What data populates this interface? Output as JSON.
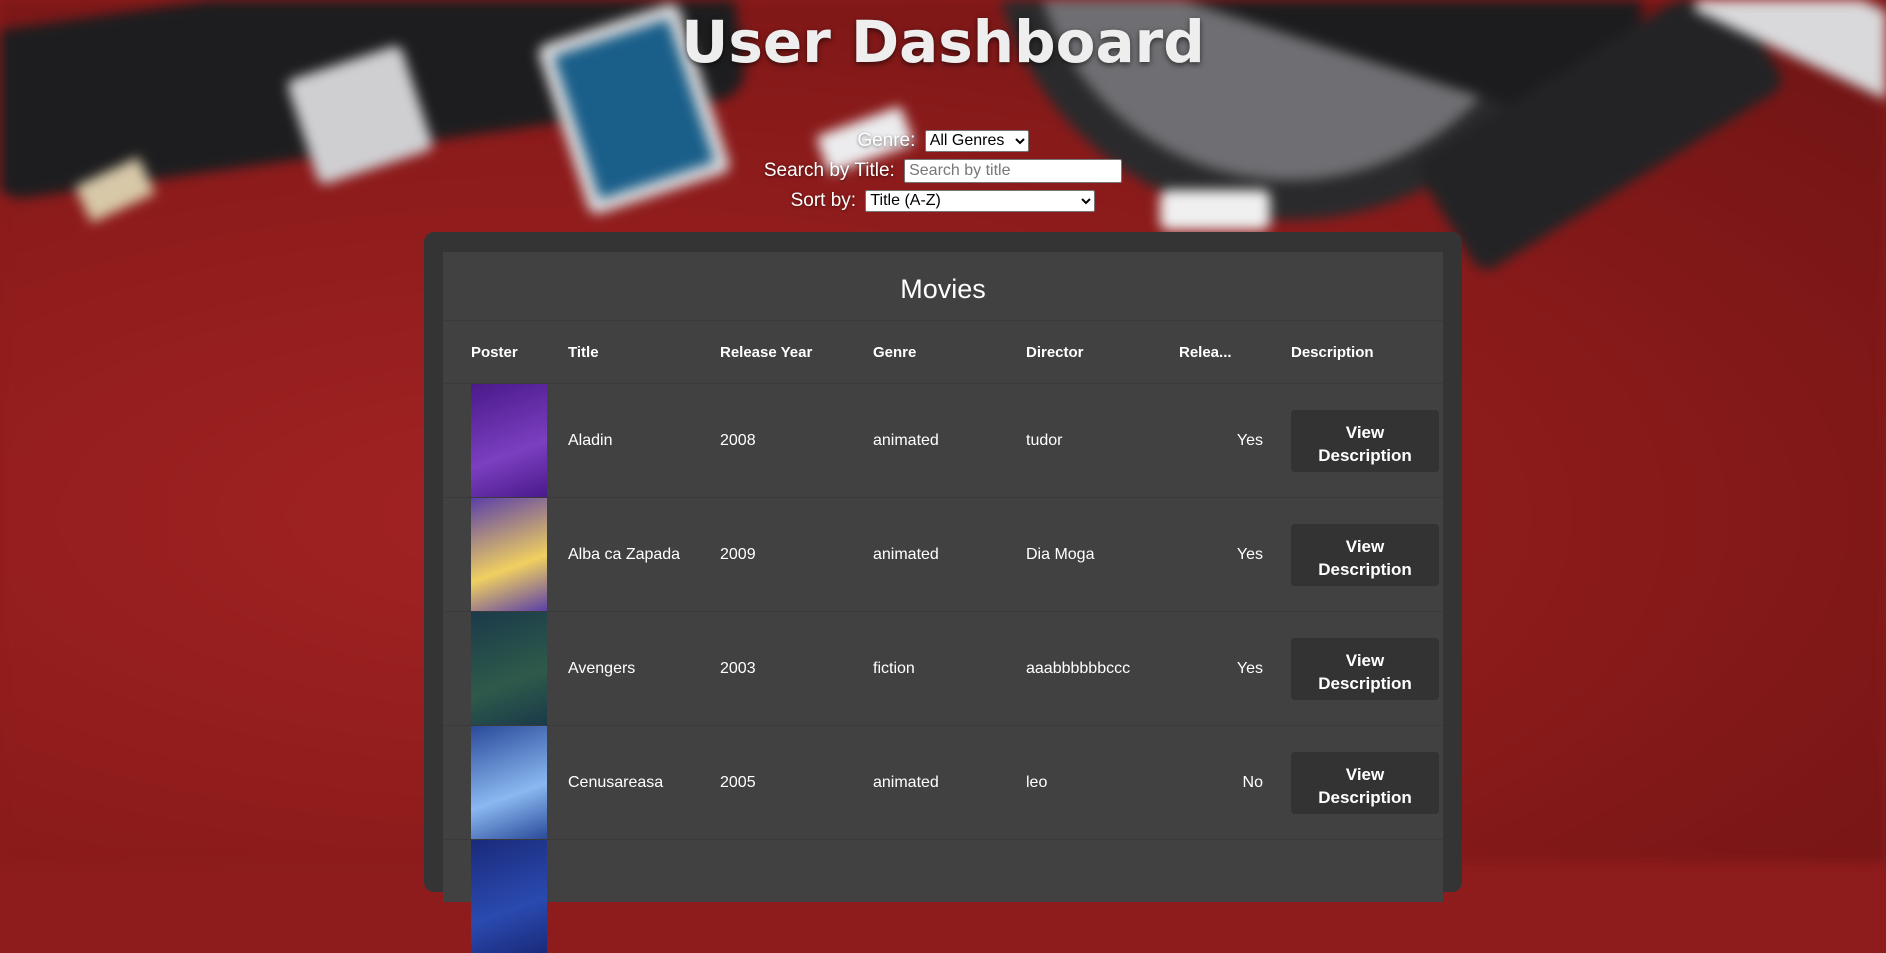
{
  "header": {
    "title": "User Dashboard"
  },
  "filters": {
    "genre_label": "Genre:",
    "genre_selected": "All Genres",
    "search_label": "Search by Title:",
    "search_placeholder": "Search by title",
    "search_value": "",
    "sort_label": "Sort by:",
    "sort_selected": "Title (A-Z)"
  },
  "movies": {
    "heading": "Movies",
    "columns": [
      "Poster",
      "Title",
      "Release Year",
      "Genre",
      "Director",
      "Relea...",
      "Description"
    ],
    "rows": [
      {
        "title": "Aladin",
        "year": "2008",
        "genre": "animated",
        "director": "tudor",
        "released": "Yes",
        "button": "View Description",
        "poster_colors": [
          "#4a1a8a",
          "#7b3fc0"
        ]
      },
      {
        "title": "Alba ca Zapada",
        "year": "2009",
        "genre": "animated",
        "director": "Dia Moga",
        "released": "Yes",
        "button": "View Description",
        "poster_colors": [
          "#5b3fa8",
          "#f0d060"
        ]
      },
      {
        "title": "Avengers",
        "year": "2003",
        "genre": "fiction",
        "director": "aaabbbbbbccc",
        "released": "Yes",
        "button": "View Description",
        "poster_colors": [
          "#1a3a4a",
          "#2e5a4a"
        ]
      },
      {
        "title": "Cenusareasa",
        "year": "2005",
        "genre": "animated",
        "director": "leo",
        "released": "No",
        "button": "View Description",
        "poster_colors": [
          "#2a4a9a",
          "#8ab8f0"
        ]
      },
      {
        "title": "",
        "year": "",
        "genre": "",
        "director": "",
        "released": "",
        "button": "",
        "poster_colors": [
          "#1a2a7a",
          "#2a4ab0"
        ]
      }
    ]
  }
}
